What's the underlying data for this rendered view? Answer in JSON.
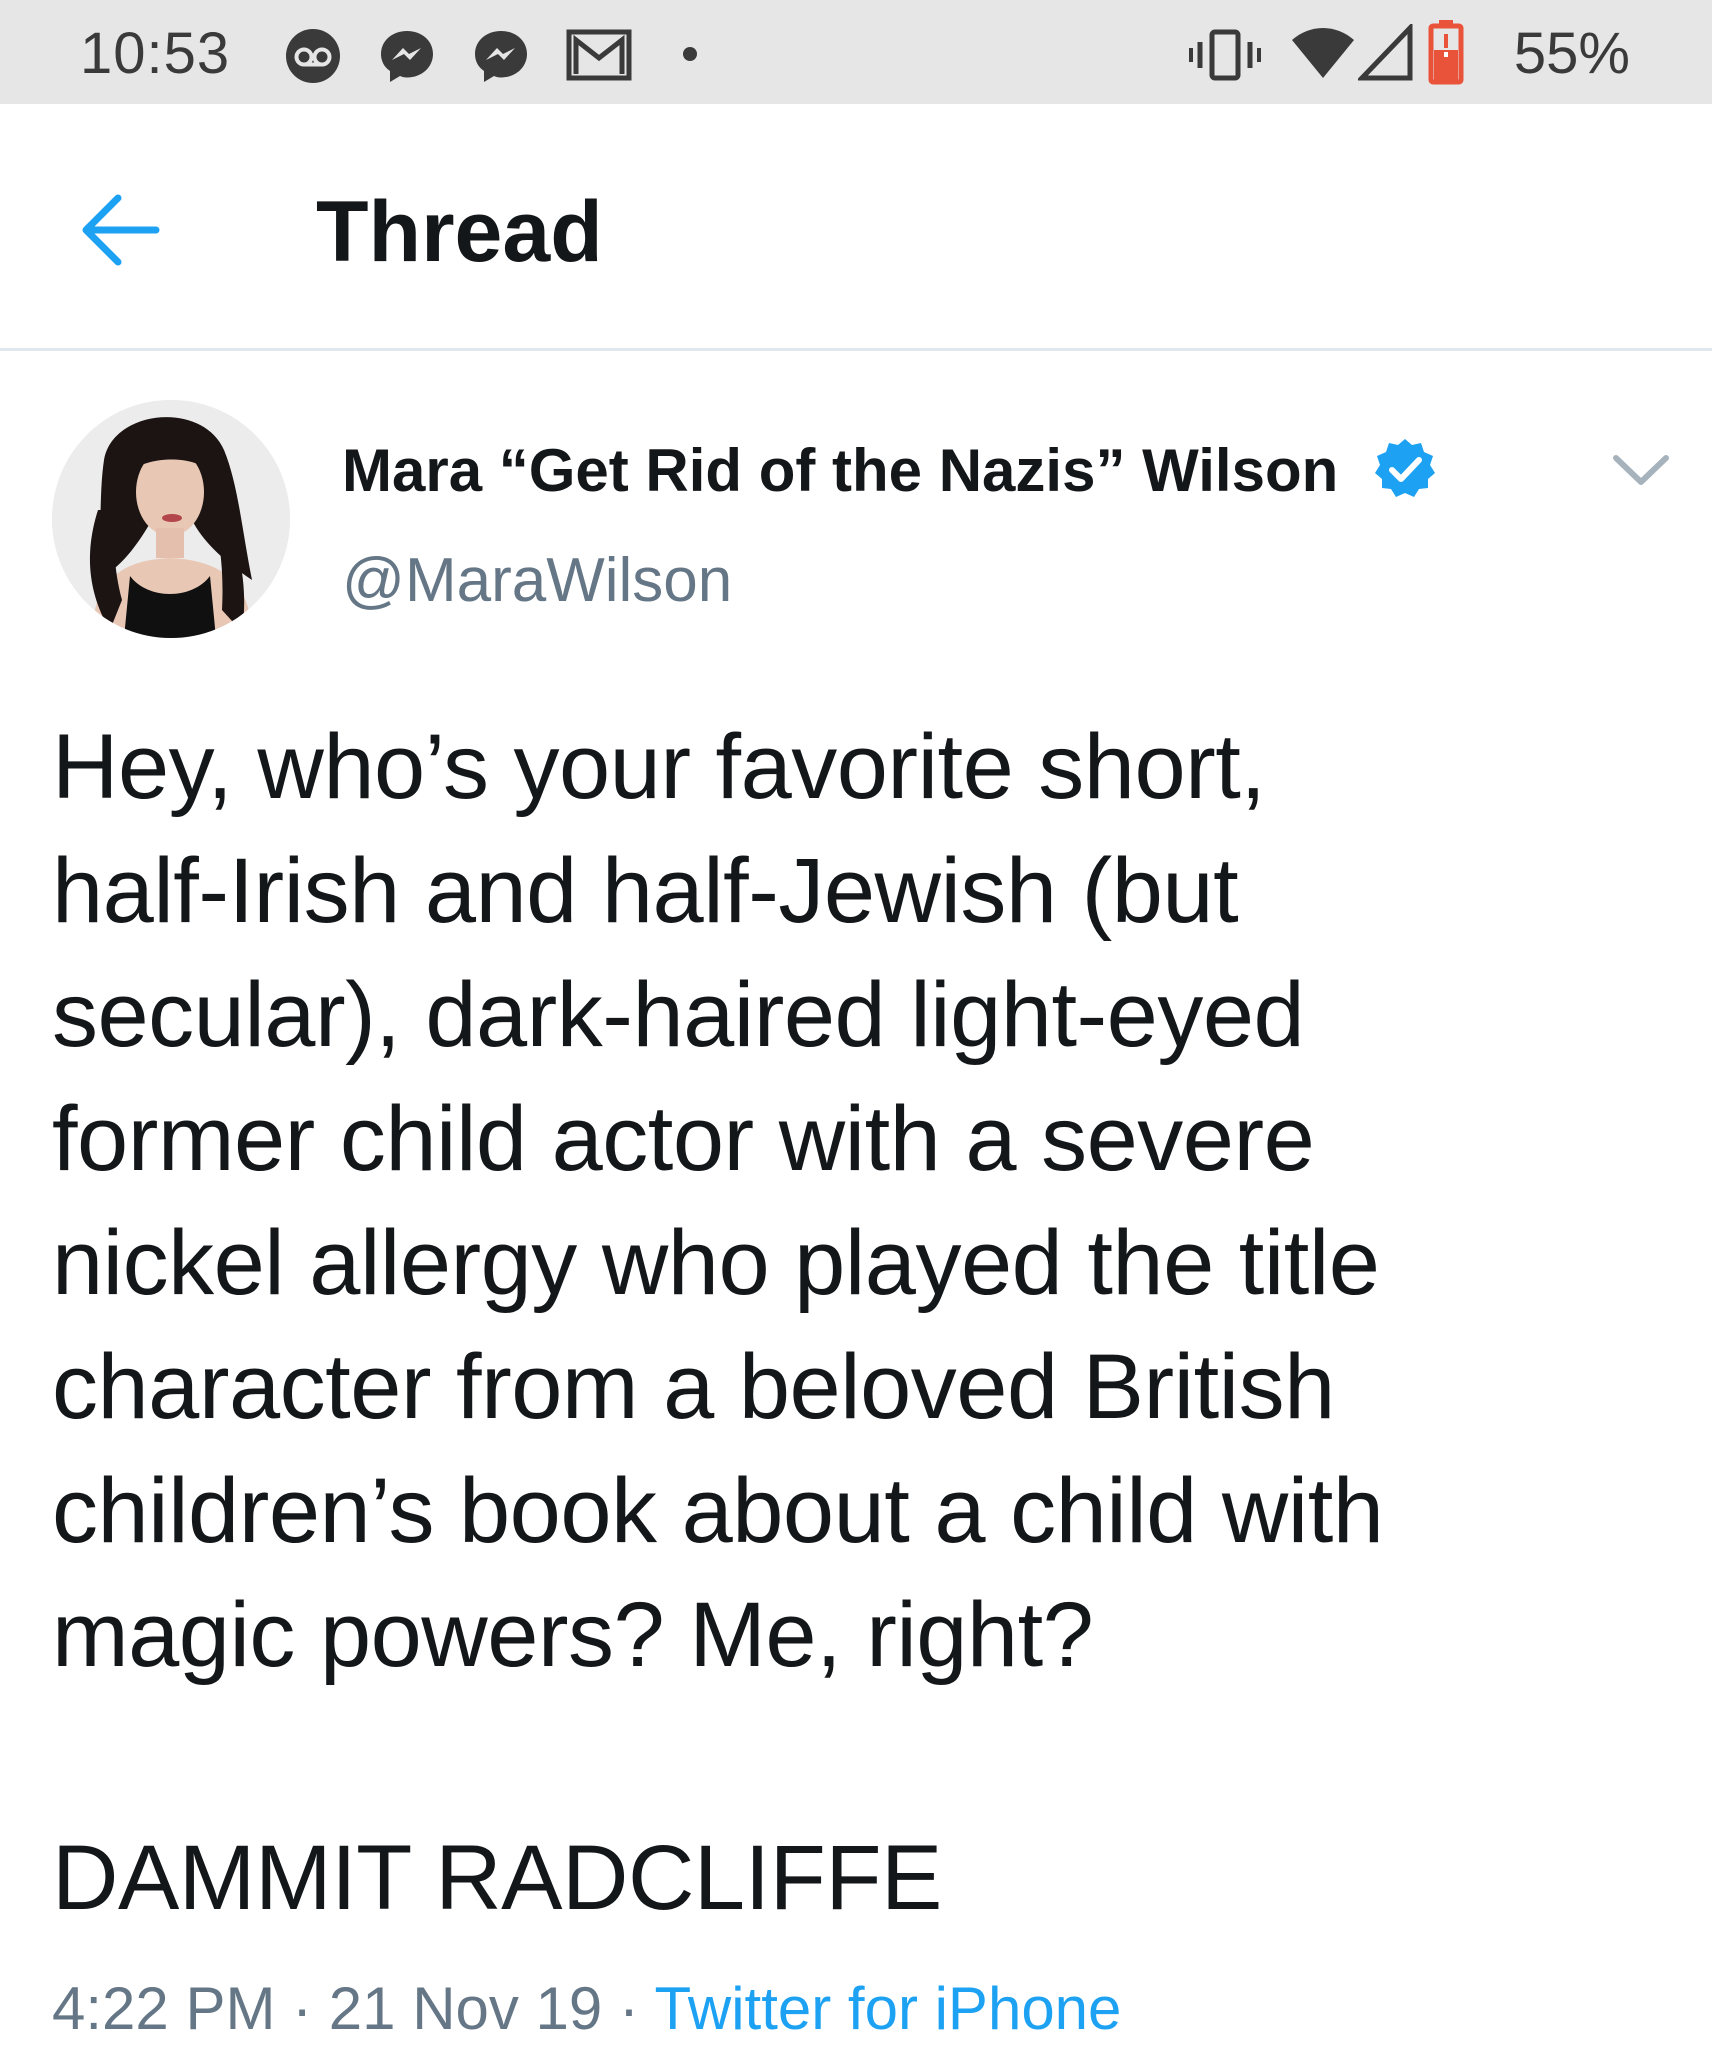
{
  "status_bar": {
    "time": "10:53",
    "notification_icons": [
      "voicemail-icon",
      "messenger-icon",
      "messenger-icon",
      "gmail-icon",
      "dot-icon"
    ],
    "system_icons": [
      "vibrate-icon",
      "wifi-icon",
      "cell-signal-icon",
      "battery-low-icon"
    ],
    "battery_percent": "55%",
    "colors": {
      "background": "#e6e6e6",
      "text": "#3a3a3a",
      "battery_alert": "#e8533a"
    }
  },
  "header": {
    "back_icon": "arrow-left-icon",
    "title": "Thread",
    "colors": {
      "back_arrow": "#1da1f2"
    }
  },
  "tweet": {
    "author": {
      "name": "Mara “Get Rid of the Nazis” Wilson",
      "handle": "@MaraWilson",
      "verified": true
    },
    "body_lines": [
      "Hey, who’s your favorite short,",
      "half-Irish and half-Jewish (but",
      "secular), dark-haired light-eyed",
      "former child actor with a severe",
      "nickel allergy who played the title",
      "character from a beloved British",
      "children’s book about a child with",
      "magic powers? Me, right?"
    ],
    "punchline": "DAMMIT RADCLIFFE",
    "meta": {
      "time": "4:22 PM",
      "separator": " · ",
      "date": "21 Nov 19",
      "source": "Twitter for iPhone"
    },
    "colors": {
      "text": "#14171a",
      "secondary": "#657786",
      "link": "#1da1f2",
      "verified": "#1da1f2"
    }
  }
}
